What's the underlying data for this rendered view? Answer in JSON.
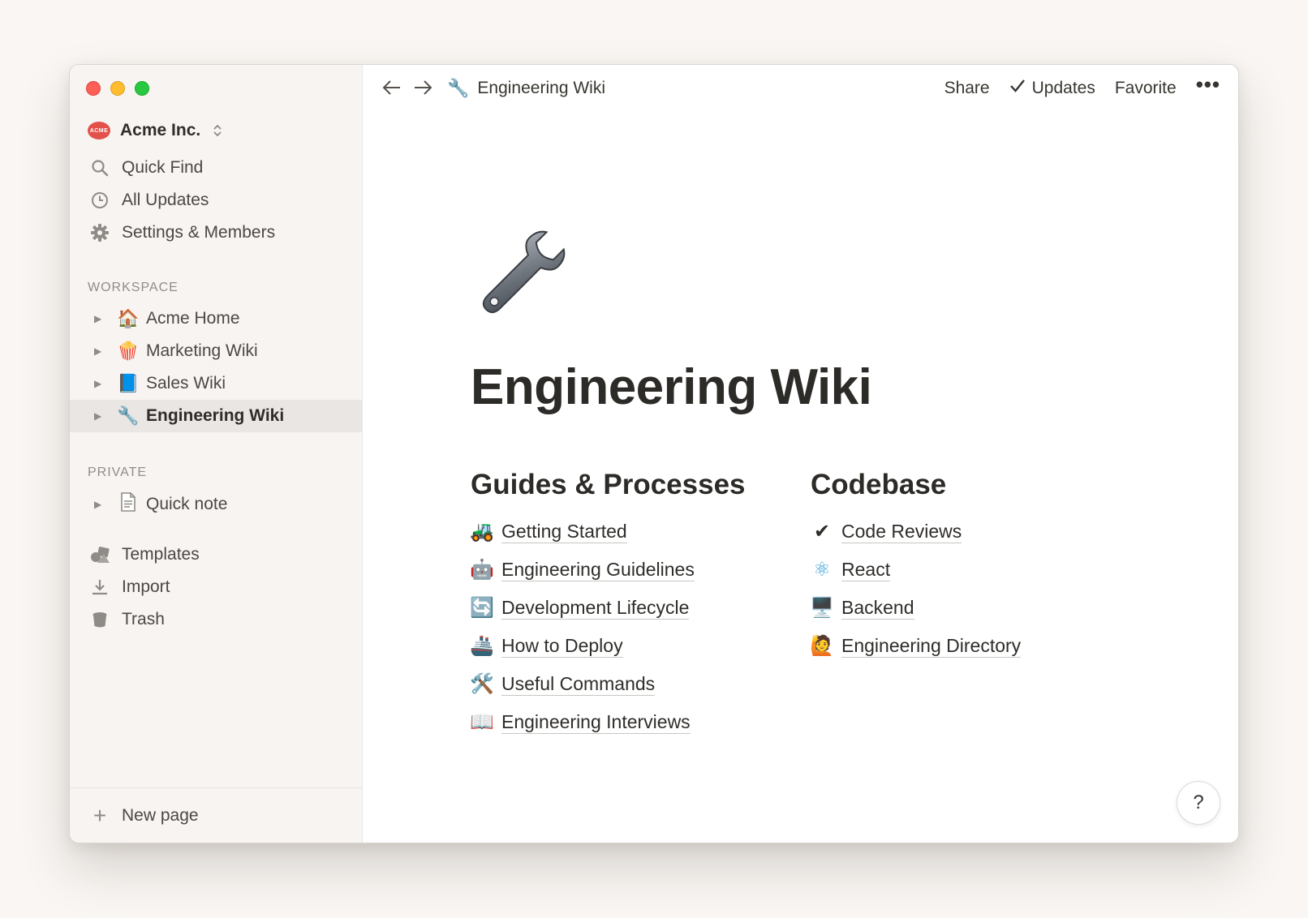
{
  "workspace": {
    "name": "Acme Inc.",
    "logo_text": "ACME"
  },
  "sidebar": {
    "nav": [
      {
        "label": "Quick Find",
        "icon": "search-icon"
      },
      {
        "label": "All Updates",
        "icon": "clock-icon"
      },
      {
        "label": "Settings & Members",
        "icon": "gear-icon"
      }
    ],
    "workspace_label": "WORKSPACE",
    "workspace_pages": [
      {
        "label": "Acme Home",
        "emoji": "🏠"
      },
      {
        "label": "Marketing Wiki",
        "emoji": "🍿"
      },
      {
        "label": "Sales Wiki",
        "emoji": "📘"
      },
      {
        "label": "Engineering Wiki",
        "emoji": "🔧",
        "active": true
      }
    ],
    "private_label": "PRIVATE",
    "private_pages": [
      {
        "label": "Quick note",
        "icon": "document-icon"
      }
    ],
    "tools": [
      {
        "label": "Templates",
        "icon": "templates-icon"
      },
      {
        "label": "Import",
        "icon": "download-icon"
      },
      {
        "label": "Trash",
        "icon": "trash-icon"
      }
    ],
    "new_page": "New page"
  },
  "topbar": {
    "breadcrumb_emoji": "🔧",
    "breadcrumb": "Engineering Wiki",
    "share": "Share",
    "updates": "Updates",
    "favorite": "Favorite",
    "more": "•••"
  },
  "page": {
    "title": "Engineering Wiki",
    "icon": "wrench-icon",
    "columns": [
      {
        "heading": "Guides & Processes",
        "links": [
          {
            "emoji": "🚜",
            "label": "Getting Started"
          },
          {
            "emoji": "🤖",
            "label": "Engineering Guidelines"
          },
          {
            "emoji": "🔄",
            "label": "Development Lifecycle"
          },
          {
            "emoji": "🚢",
            "label": "How to Deploy"
          },
          {
            "emoji": "🛠️",
            "label": "Useful Commands"
          },
          {
            "emoji": "📖",
            "label": "Engineering Interviews"
          }
        ]
      },
      {
        "heading": "Codebase",
        "links": [
          {
            "emoji": "✔",
            "label": "Code Reviews"
          },
          {
            "emoji": "⚛",
            "label": "React"
          },
          {
            "emoji": "🖥️",
            "label": "Backend"
          },
          {
            "emoji": "🙋",
            "label": "Engineering Directory"
          }
        ]
      }
    ]
  },
  "help": "?"
}
